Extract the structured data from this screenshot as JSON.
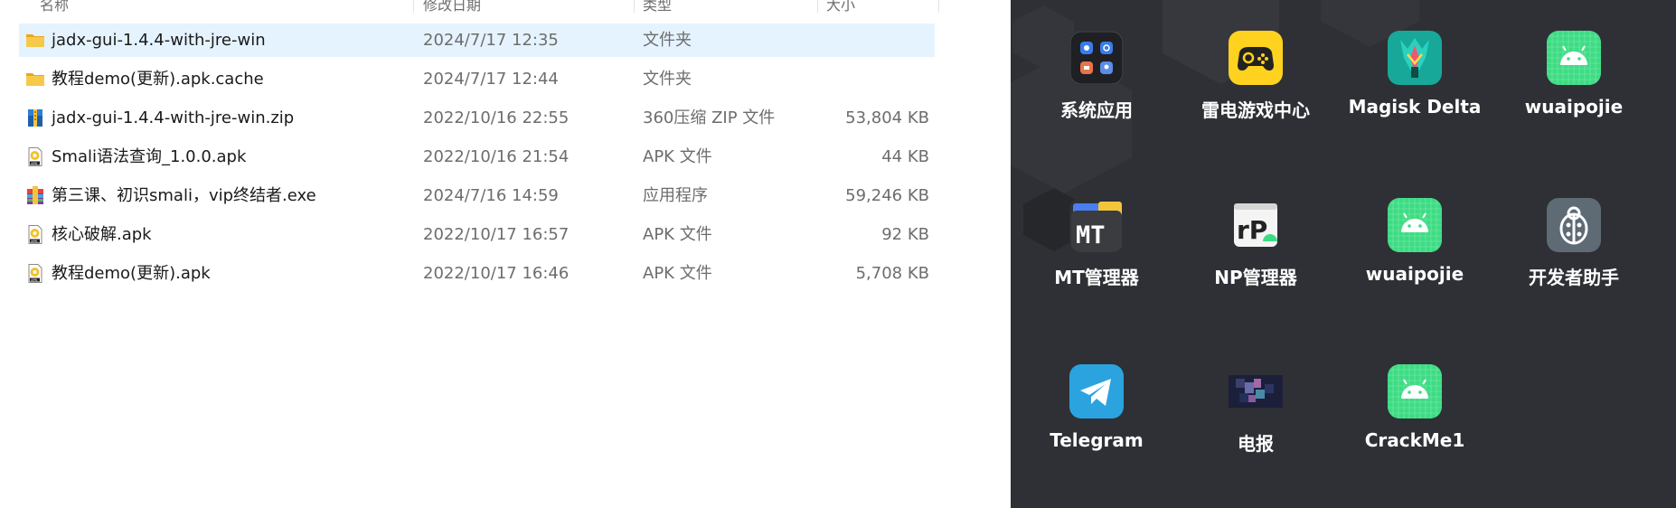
{
  "explorer": {
    "columns": [
      "名称",
      "修改日期",
      "类型",
      "大小"
    ],
    "files": [
      {
        "name": "jadx-gui-1.4.4-with-jre-win",
        "date": "2024/7/17 12:35",
        "type": "文件夹",
        "size": "",
        "icon": "folder-icon",
        "selected": true
      },
      {
        "name": "教程demo(更新).apk.cache",
        "date": "2024/7/17 12:44",
        "type": "文件夹",
        "size": "",
        "icon": "folder-icon",
        "selected": false
      },
      {
        "name": "jadx-gui-1.4.4-with-jre-win.zip",
        "date": "2022/10/16 22:55",
        "type": "360压缩 ZIP 文件",
        "size": "53,804 KB",
        "icon": "zip-archive-icon",
        "selected": false
      },
      {
        "name": "Smali语法查询_1.0.0.apk",
        "date": "2022/10/16 21:54",
        "type": "APK 文件",
        "size": "44 KB",
        "icon": "apk-file-icon",
        "selected": false
      },
      {
        "name": "第三课、初识smali，vip终结者.exe",
        "date": "2024/7/16 14:59",
        "type": "应用程序",
        "size": "59,246 KB",
        "icon": "exe-installer-icon",
        "selected": false
      },
      {
        "name": "核心破解.apk",
        "date": "2022/10/17 16:57",
        "type": "APK 文件",
        "size": "92 KB",
        "icon": "apk-file-icon",
        "selected": false
      },
      {
        "name": "教程demo(更新).apk",
        "date": "2022/10/17 16:46",
        "type": "APK 文件",
        "size": "5,708 KB",
        "icon": "apk-file-icon",
        "selected": false
      }
    ]
  },
  "launcher": {
    "background_color": "#2e3035",
    "apps": [
      {
        "label": "系统应用",
        "icon": "system-apps-folder-icon"
      },
      {
        "label": "雷电游戏中心",
        "icon": "gamepad-icon"
      },
      {
        "label": "Magisk Delta",
        "icon": "magisk-icon"
      },
      {
        "label": "wuaipojie",
        "icon": "android-icon"
      },
      {
        "label": "MT管理器",
        "icon": "mt-manager-icon"
      },
      {
        "label": "NP管理器",
        "icon": "np-manager-icon"
      },
      {
        "label": "wuaipojie",
        "icon": "android-icon"
      },
      {
        "label": "开发者助手",
        "icon": "ladybug-icon"
      },
      {
        "label": "Telegram",
        "icon": "telegram-icon"
      },
      {
        "label": "电报",
        "icon": "pixelated-image-icon"
      },
      {
        "label": "CrackMe1",
        "icon": "android-icon"
      }
    ]
  }
}
